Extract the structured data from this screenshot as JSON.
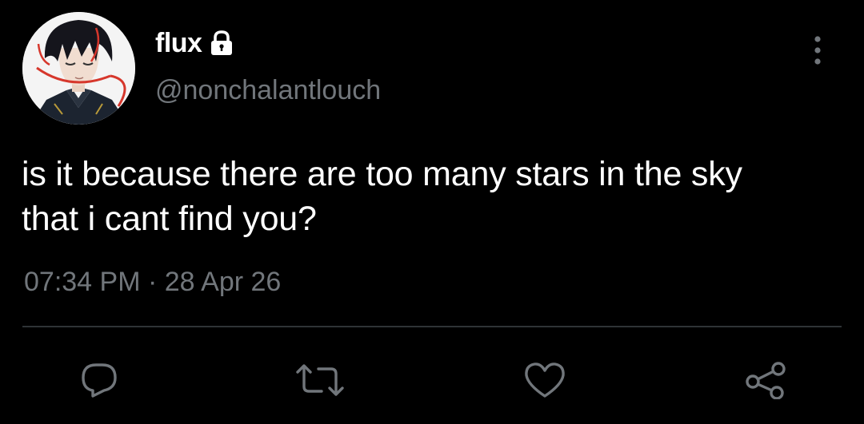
{
  "user": {
    "display_name": "flux",
    "handle": "@nonchalantlouch",
    "protected": true
  },
  "tweet": {
    "text_line1": "is it because there are too many stars in the sky",
    "text_line2": "that i cant find you?",
    "time": "07:34 PM",
    "separator": "·",
    "date": "28 Apr 26"
  },
  "icons": {
    "lock": "lock-icon",
    "more": "more-vertical-icon",
    "reply": "reply-icon",
    "retweet": "retweet-icon",
    "like": "like-icon",
    "share": "share-icon"
  },
  "colors": {
    "background": "#000000",
    "primary_text": "#ffffff",
    "secondary_text": "#71767b",
    "divider": "#2f3336"
  }
}
